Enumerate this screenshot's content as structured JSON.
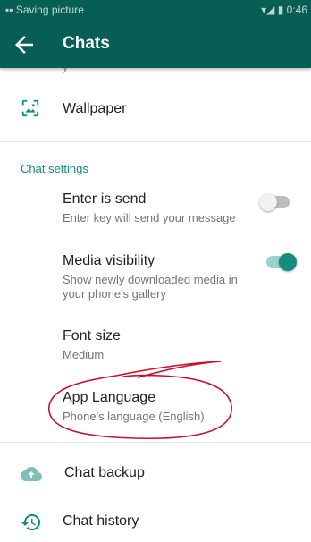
{
  "status_bar": {
    "left_text": "▪▪ Saving picture",
    "right_text": "▾◢ ▮ 0:46"
  },
  "app_bar": {
    "title": "Chats",
    "back_icon": "arrow-back-icon",
    "color": "#075e54"
  },
  "list": {
    "peek_text": "y",
    "wallpaper": {
      "label": "Wallpaper",
      "icon": "wallpaper-icon"
    },
    "section_title": "Chat settings",
    "settings": [
      {
        "label": "Enter is send",
        "sub": "Enter key will send your message",
        "toggle": false
      },
      {
        "label": "Media visibility",
        "sub": "Show newly downloaded media in your phone's gallery",
        "toggle": true
      },
      {
        "label": "Font size",
        "sub": "Medium"
      },
      {
        "label": "App Language",
        "sub": "Phone's language (English)"
      }
    ],
    "chat_backup": {
      "label": "Chat backup",
      "icon": "cloud-upload-icon"
    },
    "chat_history": {
      "label": "Chat history",
      "icon": "history-icon"
    }
  },
  "colors": {
    "accent": "#128c7e",
    "toggle_on_track": "#9ad3c7",
    "annotation": "#c8102e"
  }
}
